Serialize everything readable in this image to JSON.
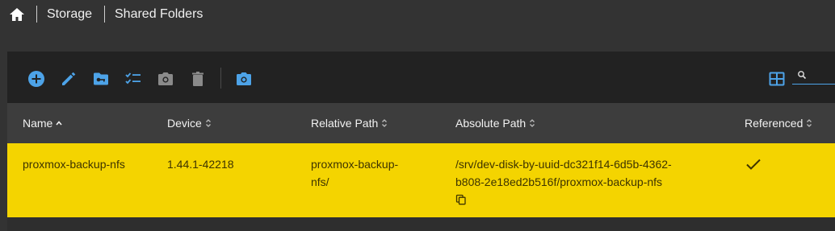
{
  "breadcrumb": {
    "items": [
      "Storage",
      "Shared Folders"
    ]
  },
  "toolbar": {
    "accent": "#4da3e8",
    "disabled_color": "#8a8a8a",
    "search": {
      "value": ""
    }
  },
  "table": {
    "columns": [
      {
        "label": "Name",
        "sort": "asc"
      },
      {
        "label": "Device",
        "sort": "none"
      },
      {
        "label": "Relative Path",
        "sort": "none"
      },
      {
        "label": "Absolute Path",
        "sort": "none"
      },
      {
        "label": "Referenced",
        "sort": "none"
      }
    ],
    "rows": [
      {
        "name": "proxmox-backup-nfs",
        "device": "1.44.1-42218",
        "relative_path_line1": "proxmox-backup-",
        "relative_path_line2": "nfs/",
        "absolute_path_line1": "/srv/dev-disk-by-uuid-dc321f14-6d5b-4362-",
        "absolute_path_line2": "b808-2e18ed2b516f/proxmox-backup-nfs",
        "referenced": true,
        "selected": true
      }
    ],
    "selected_row_color": "#f4d400"
  }
}
